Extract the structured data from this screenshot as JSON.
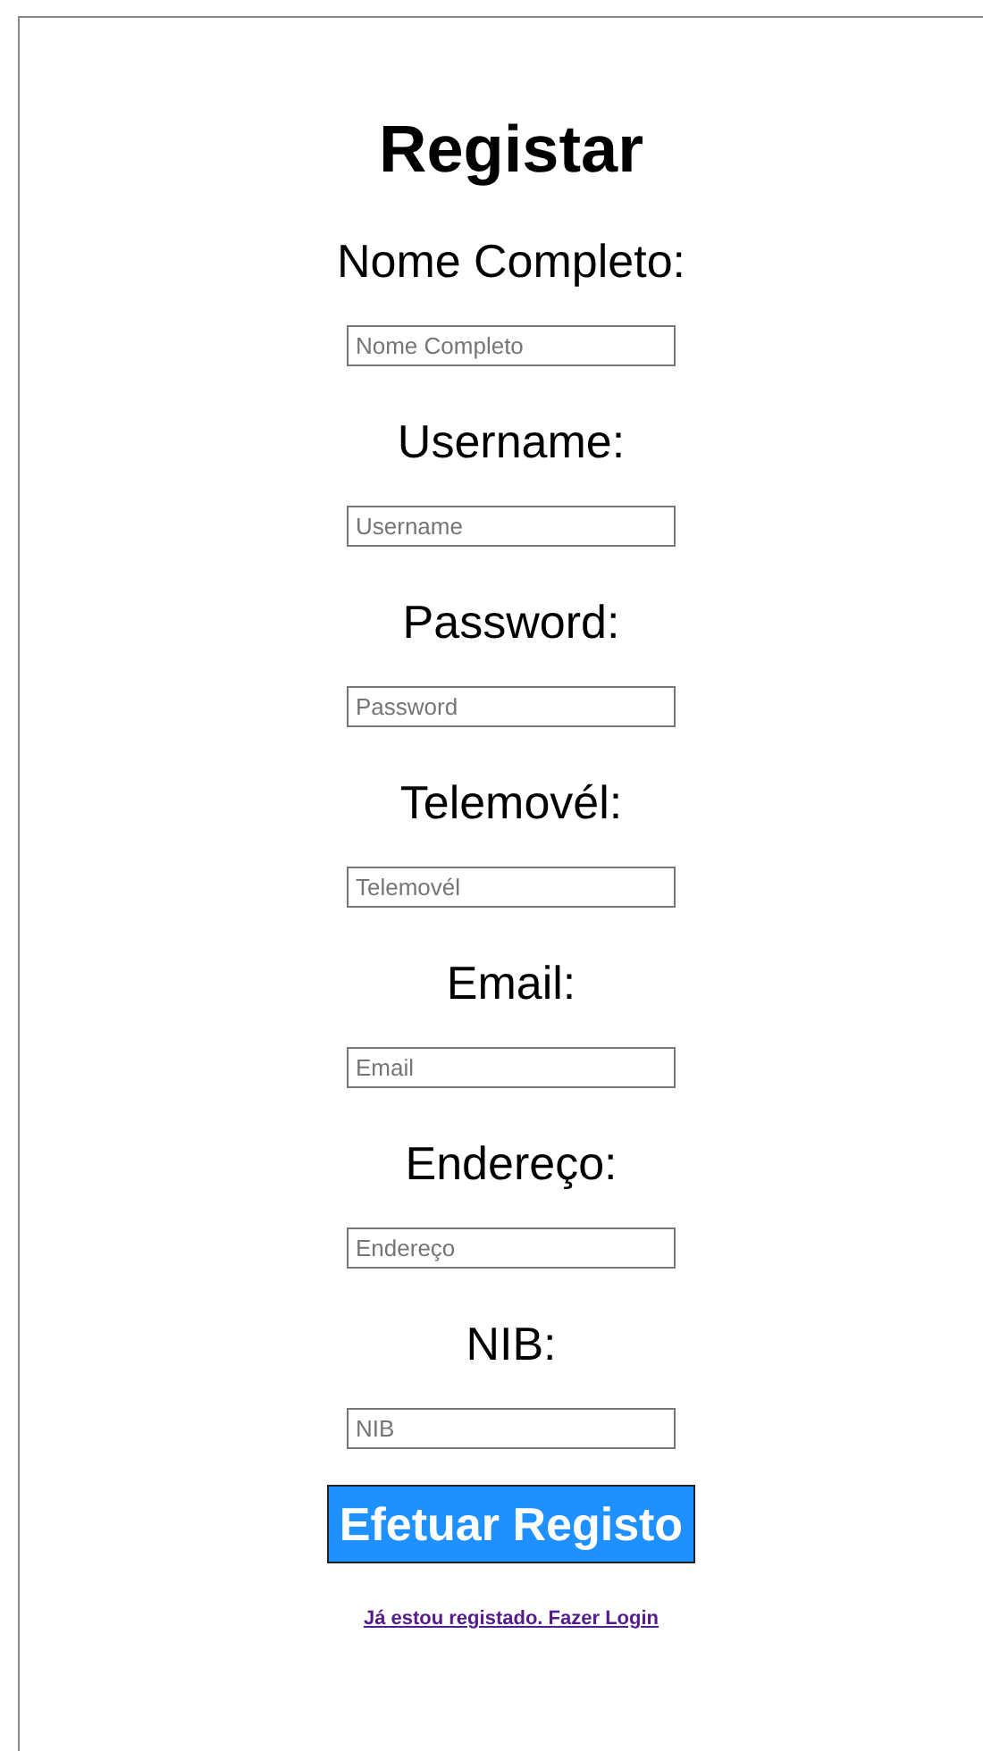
{
  "title": "Registar",
  "fields": [
    {
      "label": "Nome Completo:",
      "placeholder": "Nome Completo"
    },
    {
      "label": "Username:",
      "placeholder": "Username"
    },
    {
      "label": "Password:",
      "placeholder": "Password"
    },
    {
      "label": "Telemovél:",
      "placeholder": "Telemovél"
    },
    {
      "label": "Email:",
      "placeholder": "Email"
    },
    {
      "label": "Endereço:",
      "placeholder": "Endereço"
    },
    {
      "label": "NIB:",
      "placeholder": "NIB"
    }
  ],
  "submit_button": "Efetuar Registo",
  "login_link": "Já estou registado. Fazer Login"
}
